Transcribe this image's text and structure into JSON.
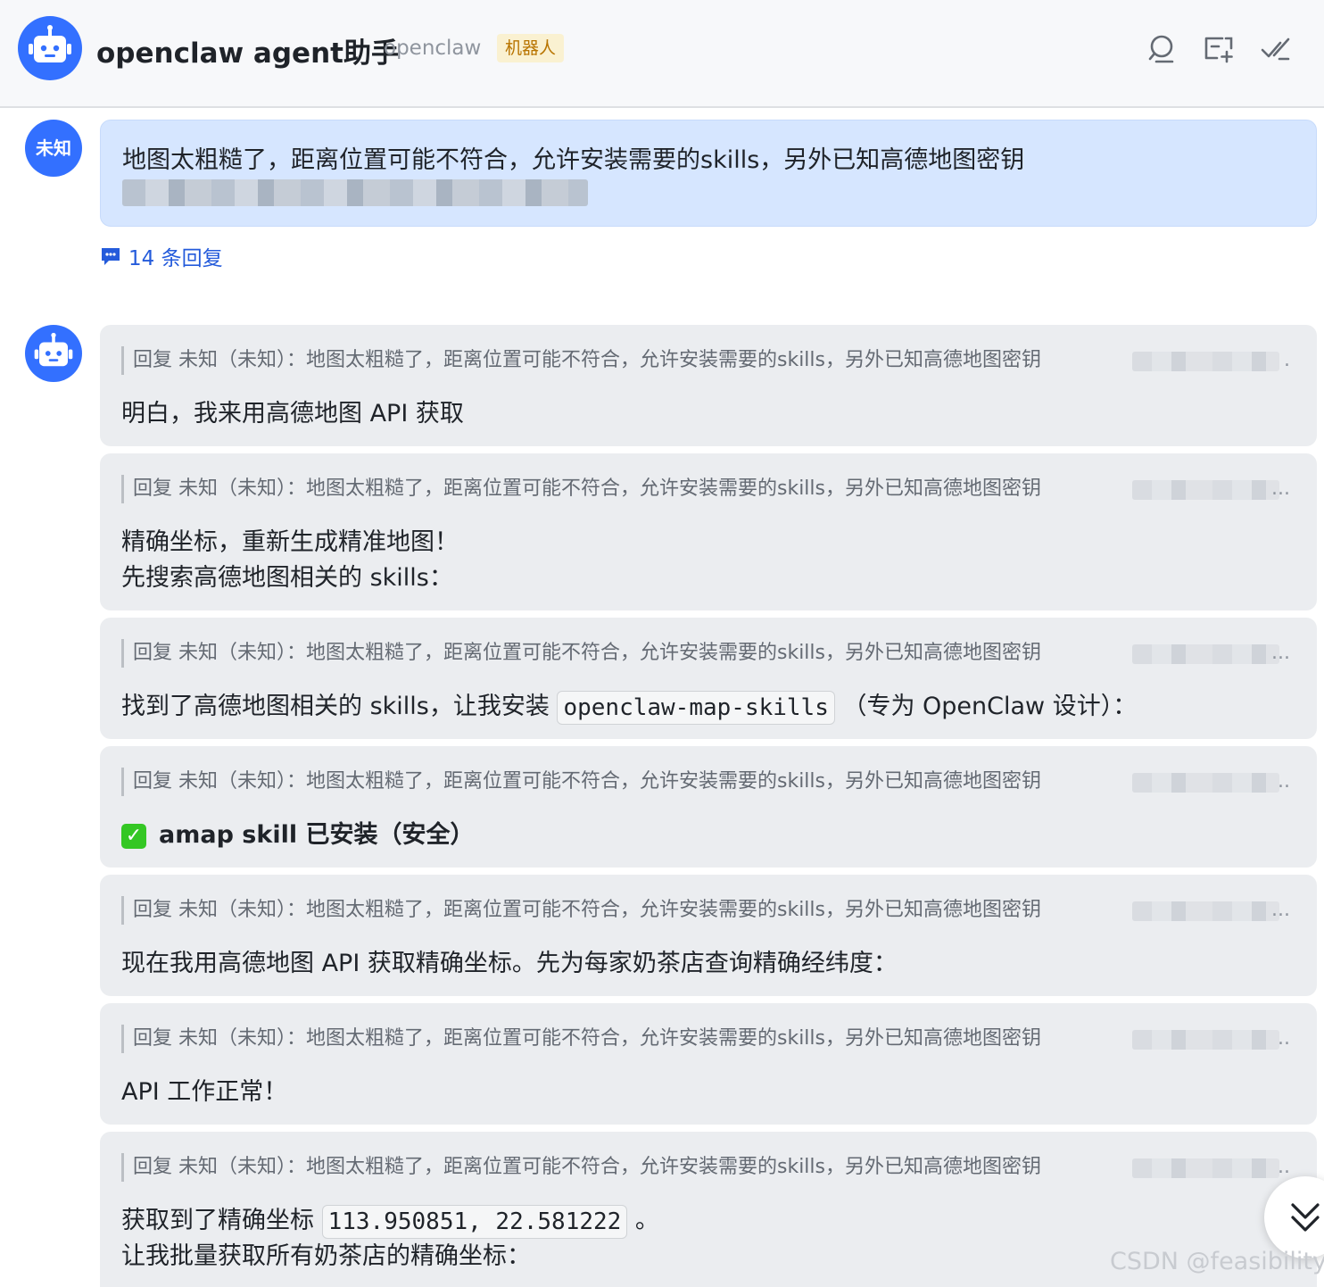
{
  "header": {
    "title": "openclaw agent助手",
    "subtitle": "openclaw",
    "badge": "机器人",
    "icons": [
      "search-icon",
      "create-chat-icon",
      "done-icon"
    ]
  },
  "user_message": {
    "avatar_label": "未知",
    "text": "地图太粗糙了，距离位置可能不符合，允许安装需要的skills，另外已知高德地图密钥"
  },
  "thread": {
    "reply_count_label": "14 条回复"
  },
  "replies": [
    {
      "quote": "回复 未知（未知）：地图太粗糙了，距离位置可能不符合，允许安装需要的skills，另外已知高德地图密钥",
      "ellipsis": ".",
      "lines": [
        "明白，我来用高德地图 API 获取"
      ]
    },
    {
      "quote": "回复 未知（未知）：地图太粗糙了，距离位置可能不符合，允许安装需要的skills，另外已知高德地图密钥",
      "ellipsis": "...",
      "lines": [
        "精确坐标，重新生成精准地图！",
        "先搜索高德地图相关的 skills："
      ]
    },
    {
      "quote": "回复 未知（未知）：地图太粗糙了，距离位置可能不符合，允许安装需要的skills，另外已知高德地图密钥",
      "ellipsis": "...",
      "before": "找到了高德地图相关的 skills，让我安装 ",
      "code": "openclaw-map-skills",
      "after": " （专为 OpenClaw 设计）："
    },
    {
      "quote": "回复 未知（未知）：地图太粗糙了，距离位置可能不符合，允许安装需要的skills，另外已知高德地图密钥",
      "ellipsis": "..",
      "check_text": "amap skill 已安装（安全）"
    },
    {
      "quote": "回复 未知（未知）：地图太粗糙了，距离位置可能不符合，允许安装需要的skills，另外已知高德地图密钥",
      "ellipsis": "...",
      "lines": [
        "现在我用高德地图 API 获取精确坐标。先为每家奶茶店查询精确经纬度："
      ]
    },
    {
      "quote": "回复 未知（未知）：地图太粗糙了，距离位置可能不符合，允许安装需要的skills，另外已知高德地图密钥",
      "ellipsis": "..",
      "lines": [
        "API 工作正常！"
      ]
    },
    {
      "quote": "回复 未知（未知）：地图太粗糙了，距离位置可能不符合，允许安装需要的skills，另外已知高德地图密钥",
      "ellipsis": "..",
      "before": "获取到了精确坐标 ",
      "code": "113.950851, 22.581222",
      "after": " 。",
      "line2": "让我批量获取所有奶茶店的精确坐标："
    }
  ],
  "watermark": "CSDN @feasibility.",
  "colors": {
    "accent": "#3370ff",
    "user_bubble": "#d6e6ff",
    "card_bg": "#ebedf0",
    "badge_bg": "#faf1d1",
    "badge_text": "#b87400"
  }
}
